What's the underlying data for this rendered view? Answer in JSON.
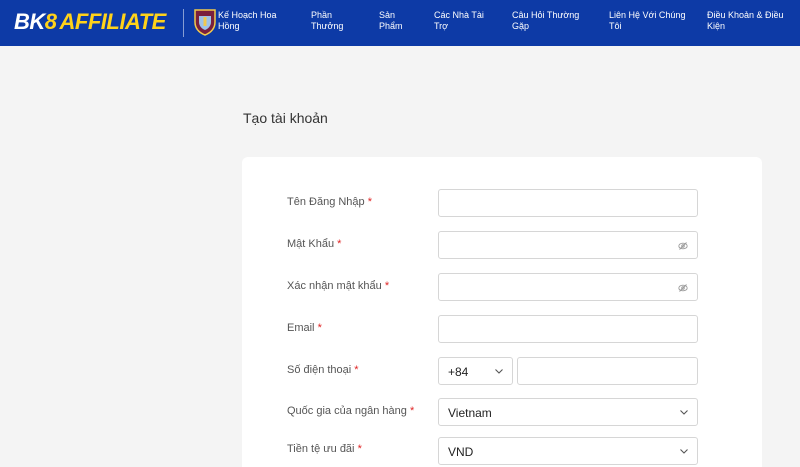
{
  "header": {
    "logo_bk": "BK",
    "logo_eight": "8",
    "logo_affiliate": "AFFILIATE",
    "nav": [
      {
        "line1": "Kế Hoạch Hoa",
        "line2": "Hồng"
      },
      {
        "line1": "Phần",
        "line2": "Thưởng"
      },
      {
        "line1": "Sản",
        "line2": "Phẩm"
      },
      {
        "line1": "Các Nhà Tài",
        "line2": "Trợ"
      },
      {
        "line1": "Câu Hỏi Thường",
        "line2": "Gặp"
      },
      {
        "line1": "Liên Hệ Với Chúng",
        "line2": "Tôi"
      },
      {
        "line1": "Điều Khoản & Điều",
        "line2": "Kiện"
      }
    ]
  },
  "page": {
    "title": "Tạo tài khoản"
  },
  "form": {
    "required_mark": "*",
    "username_label": "Tên Đăng Nhập",
    "password_label": "Mật Khẩu",
    "confirm_password_label": "Xác nhận mật khẩu",
    "email_label": "Email",
    "phone_label": "Số điện thoại",
    "phone_code": "+84",
    "bank_country_label": "Quốc gia của ngân hàng",
    "bank_country_value": "Vietnam",
    "currency_label": "Tiền tệ ưu đãi",
    "currency_value": "VND"
  },
  "icons": {
    "password_toggle": "eye-off-icon",
    "dropdown": "chevron-down-icon",
    "crest": "club-crest-icon"
  },
  "colors": {
    "header_bg": "#0d3aa6",
    "logo_accent": "#ffd21a",
    "required": "#e02424"
  }
}
